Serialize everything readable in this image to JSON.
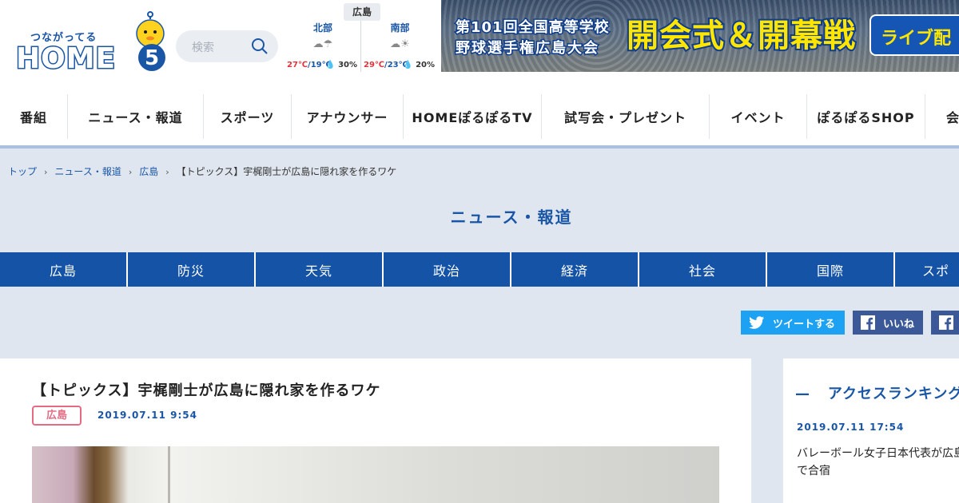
{
  "header": {
    "logo": {
      "tagline": "つながってる",
      "name": "HOME",
      "channel": "5"
    },
    "search": {
      "placeholder": "検索"
    },
    "weather": {
      "region": "広島",
      "areas": [
        {
          "name": "北部",
          "icon": "cloud-rain-icon",
          "high": "27℃",
          "low": "19℃",
          "rain": "30%"
        },
        {
          "name": "南部",
          "icon": "cloud-sun-icon",
          "high": "29℃",
          "low": "23℃",
          "rain": "20%"
        }
      ]
    },
    "banner": {
      "line1": "第101回全国高等学校",
      "line2": "野球選手権広島大会",
      "main": "開会式＆開幕戦",
      "live": "ライブ配"
    }
  },
  "global_nav": [
    {
      "label": "番組"
    },
    {
      "label": "ニュース・報道"
    },
    {
      "label": "スポーツ"
    },
    {
      "label": "アナウンサー"
    },
    {
      "label": "HOMEぽるぽるTV"
    },
    {
      "label": "試写会・プレゼント"
    },
    {
      "label": "イベント"
    },
    {
      "label": "ぽるぽるSHOP"
    },
    {
      "label": "会"
    }
  ],
  "breadcrumb": {
    "items": [
      "トップ",
      "ニュース・報道",
      "広島"
    ],
    "current": "【トピックス】宇梶剛士が広島に隠れ家を作るワケ"
  },
  "section_title": "ニュース・報道",
  "categories": [
    "広島",
    "防災",
    "天気",
    "政治",
    "経済",
    "社会",
    "国際",
    "スポ"
  ],
  "share": {
    "twitter": "ツイートする",
    "facebook": "いいね"
  },
  "article": {
    "title": "【トピックス】宇梶剛士が広島に隠れ家を作るワケ",
    "tag": "広島",
    "date": "2019.07.11 9:54"
  },
  "ranking": {
    "title": "アクセスランキング",
    "items": [
      {
        "date": "2019.07.11 17:54",
        "text": "バレーボール女子日本代表が広島で合宿"
      }
    ]
  },
  "colors": {
    "brand_blue": "#1553a6",
    "tag_pink": "#e56b85",
    "twitter": "#1da1f2",
    "facebook": "#3b5998",
    "page_bg": "#dfe6ef"
  }
}
